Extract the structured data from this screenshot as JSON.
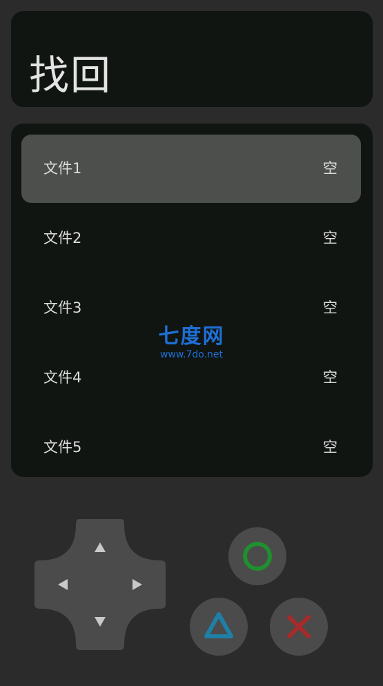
{
  "header": {
    "title": "找回"
  },
  "file_list": {
    "items": [
      {
        "name": "文件1",
        "status": "空",
        "selected": true
      },
      {
        "name": "文件2",
        "status": "空",
        "selected": false
      },
      {
        "name": "文件3",
        "status": "空",
        "selected": false
      },
      {
        "name": "文件4",
        "status": "空",
        "selected": false
      },
      {
        "name": "文件5",
        "status": "空",
        "selected": false
      }
    ]
  },
  "watermark": {
    "brand": "七度网",
    "url": "www.7do.net"
  },
  "controller": {
    "dpad_icons": [
      "arrow-up-icon",
      "arrow-left-icon",
      "arrow-right-icon",
      "arrow-down-icon"
    ],
    "face_buttons": [
      {
        "icon": "circle-icon",
        "color": "#1f8f2f"
      },
      {
        "icon": "triangle-icon",
        "color": "#1f7fa6"
      },
      {
        "icon": "cross-icon",
        "color": "#a82a2a"
      }
    ]
  },
  "colors": {
    "background": "#2b2b2b",
    "panel": "#101512",
    "selected_row": "#4d4f4d",
    "button": "#4a4b4a"
  }
}
